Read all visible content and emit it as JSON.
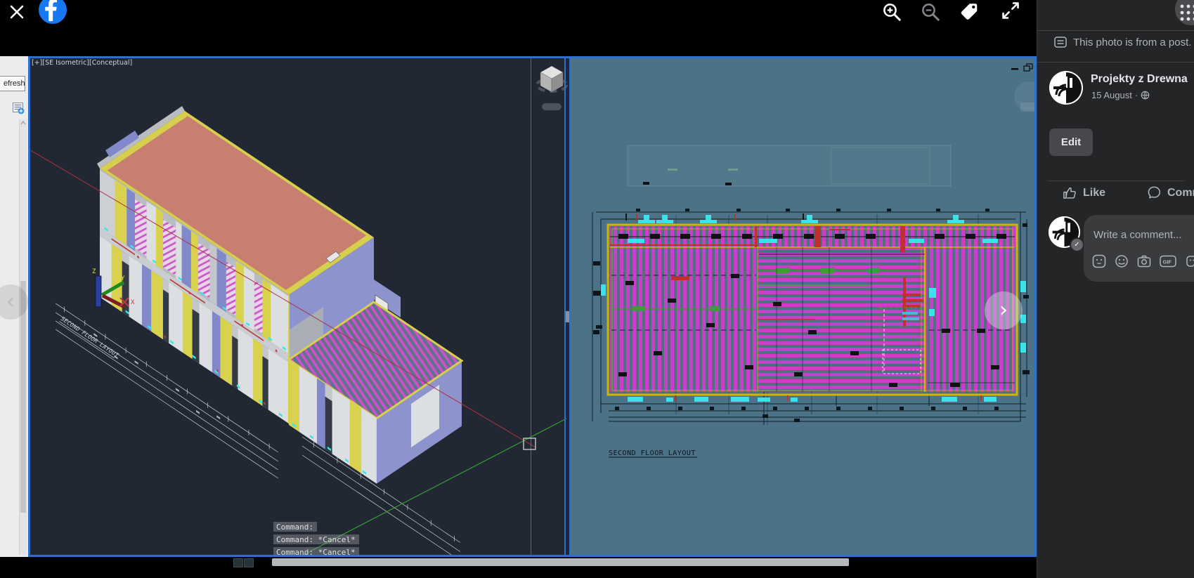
{
  "topbar": {
    "close_icon": "x",
    "tools": [
      "zoom-in",
      "zoom-out",
      "tag",
      "expand"
    ]
  },
  "sidebar": {
    "post_note": "This photo is from a post.",
    "page_name": "Projekty z Drewna",
    "post_date": "15 August",
    "date_sep": "·",
    "edit_button": "Edit",
    "actions": {
      "like": "Like",
      "comment": "Comment"
    },
    "composer": {
      "placeholder": "Write a comment...",
      "gif_badge": "GIF"
    }
  },
  "cad": {
    "viewport_label": "[+][SE Isometric][Conceptual]",
    "refresh_button": "efresh",
    "command_lines": [
      "Command:",
      "Command: *Cancel*",
      "Command: *Cancel*"
    ],
    "plan_title": "SECOND FLOOR LAYOUT",
    "ucs_labels": {
      "x": "X",
      "y": "Y",
      "z": "Z"
    }
  },
  "colors": {
    "facebook_blue": "#1877f2",
    "sidebar_bg": "#242526",
    "bubble_bg": "#3a3b3c",
    "text_primary": "#e4e6eb",
    "text_secondary": "#b0b3b8",
    "viewport_dark_bg": "#222833",
    "viewport_blue_bg": "#4b7287",
    "viewport_border_blue": "#2e6fd0",
    "plan_magenta": "#c93fc9",
    "cad_yellow": "#d2b400",
    "roof_salmon": "#c97f6f",
    "panel_purple": "#8289cb",
    "cad_cyan": "#39e3ea",
    "cad_red": "#c03a3a",
    "axis_green": "#2f9e2f"
  }
}
